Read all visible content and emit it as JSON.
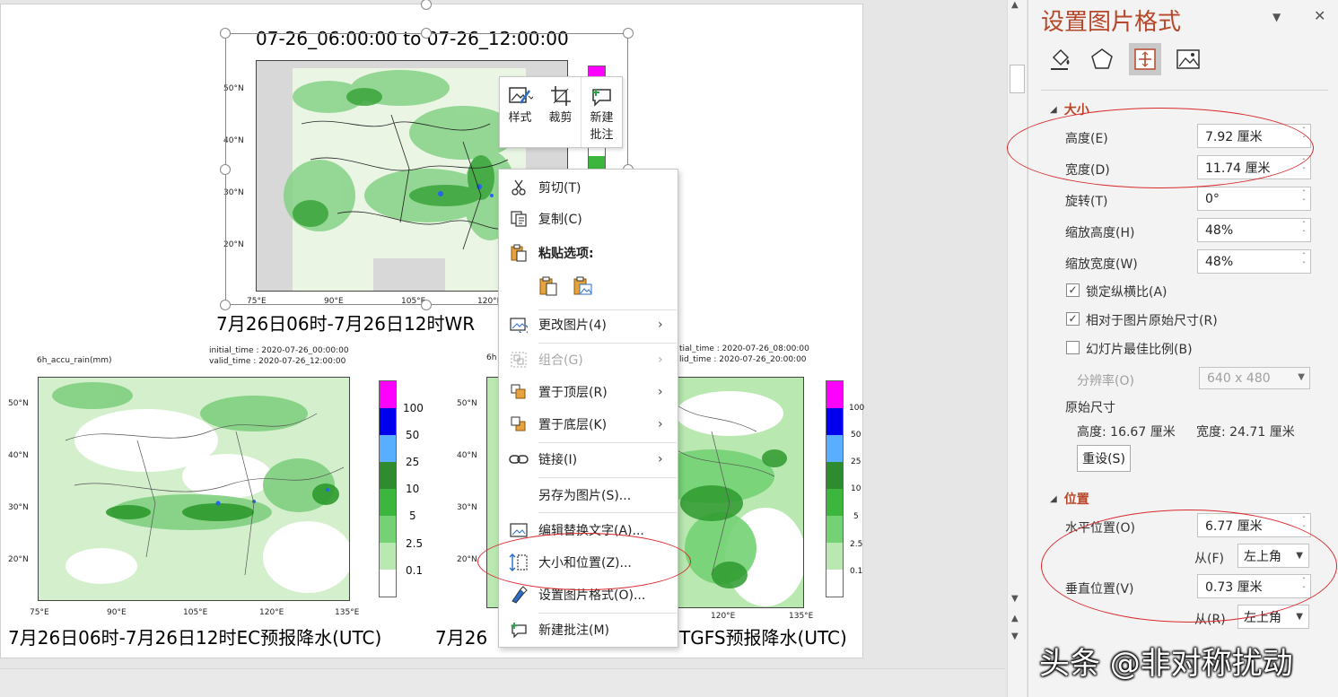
{
  "slide": {
    "top_map": {
      "title": "07-26_06:00:00 to 07-26_12:00:00",
      "lat_labels": [
        "50°N",
        "40°N",
        "30°N",
        "20°N"
      ],
      "lon_labels": [
        "75°E",
        "90°E",
        "105°E",
        "120°E"
      ],
      "caption": "7月26日06时-7月26日12时WR"
    },
    "left_map": {
      "var_label": "6h_accu_rain(mm)",
      "init_time": "initial_time : 2020-07-26_00:00:00",
      "valid_time": "valid_time : 2020-07-26_12:00:00",
      "lat_labels": [
        "50°N",
        "40°N",
        "30°N",
        "20°N"
      ],
      "lon_labels": [
        "75°E",
        "90°E",
        "105°E",
        "120°E",
        "135°E"
      ],
      "colorbar_labels": [
        "100",
        "50",
        "25",
        "10",
        "5",
        "2.5",
        "0.1"
      ],
      "caption": "7月26日06时-7月26日12时EC预报降水(UTC)"
    },
    "right_map": {
      "var_label": "6h",
      "init_time": "tial_time : 2020-07-26_08:00:00",
      "valid_time": "lid_time : 2020-07-26_20:00:00",
      "lat_labels": [
        "50°N",
        "40°N",
        "30°N",
        "20°N"
      ],
      "lon_labels": [
        "120°E",
        "135°E"
      ],
      "colorbar_labels": [
        "100",
        "50",
        "25",
        "10",
        "5",
        "2.5",
        "0.1"
      ],
      "caption_left": "7月26",
      "caption_right": "TGFS预报降水(UTC)"
    },
    "colorbar_colors": [
      "#ff00ff",
      "#0000ee",
      "#5aaeff",
      "#2e8b2e",
      "#3cb63c",
      "#74d274",
      "#b9e8b0",
      "#ffffff"
    ]
  },
  "mini_toolbar": {
    "style_label": "样式",
    "crop_label": "裁剪",
    "comment_label_1": "新建",
    "comment_label_2": "批注"
  },
  "context_menu": {
    "items": [
      {
        "label": "剪切(T)",
        "icon": "scissors-icon"
      },
      {
        "label": "复制(C)",
        "icon": "copy-icon"
      },
      {
        "label": "粘贴选项:",
        "icon": "paste-icon"
      },
      {
        "label": "更改图片(4)",
        "icon": "change-picture-icon"
      },
      {
        "label": "组合(G)",
        "icon": "group-icon"
      },
      {
        "label": "置于顶层(R)",
        "icon": "bring-front-icon"
      },
      {
        "label": "置于底层(K)",
        "icon": "send-back-icon"
      },
      {
        "label": "链接(I)",
        "icon": "link-icon"
      },
      {
        "label": "另存为图片(S)...",
        "icon": ""
      },
      {
        "label": "编辑替换文字(A)...",
        "icon": "alt-text-icon"
      },
      {
        "label": "大小和位置(Z)...",
        "icon": "size-position-icon"
      },
      {
        "label": "设置图片格式(O)...",
        "icon": "format-picture-icon"
      },
      {
        "label": "新建批注(M)",
        "icon": "new-comment-icon"
      }
    ]
  },
  "panel": {
    "title": "设置图片格式",
    "size_section": "大小",
    "height_label": "高度(E)",
    "height_value": "7.92 厘米",
    "width_label": "宽度(D)",
    "width_value": "11.74 厘米",
    "rotation_label": "旋转(T)",
    "rotation_value": "0°",
    "scale_h_label": "缩放高度(H)",
    "scale_h_value": "48%",
    "scale_w_label": "缩放宽度(W)",
    "scale_w_value": "48%",
    "lock_aspect_label": "锁定纵横比(A)",
    "relative_label": "相对于图片原始尺寸(R)",
    "best_scale_label": "幻灯片最佳比例(B)",
    "resolution_label": "分辨率(O)",
    "resolution_value": "640 x 480",
    "original_size_label": "原始尺寸",
    "orig_height": "高度:  16.67 厘米",
    "orig_width": "宽度:  24.71 厘米",
    "reset_label": "重设(S)",
    "position_section": "位置",
    "h_pos_label": "水平位置(O)",
    "h_pos_value": "6.77 厘米",
    "from_f_label": "从(F)",
    "from_f_value": "左上角",
    "v_pos_label": "垂直位置(V)",
    "v_pos_value": "0.73 厘米",
    "from_r_label": "从(R)",
    "from_r_value": "左上角",
    "lock_aspect_checked": true,
    "relative_checked": true,
    "best_scale_checked": false
  },
  "watermark": "头条 @非对称扰动",
  "annotation_color": "#d9282c",
  "accent_color": "#b7472a"
}
